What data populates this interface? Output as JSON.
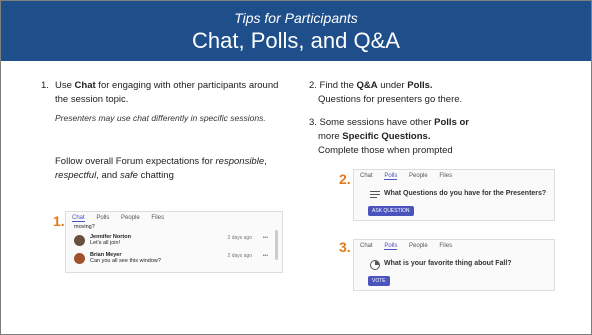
{
  "header": {
    "subtitle": "Tips for Participants",
    "title": "Chat, Polls, and Q&A",
    "band_color": "#1f4f8b"
  },
  "left": {
    "num": "1.",
    "line1_pre": "Use ",
    "line1_bold": "Chat",
    "line1_post": " for engaging with other participants around the session topic.",
    "note": "Presenters may use chat differently in specific sessions.",
    "follow_pre": "Follow overall Forum expectations for ",
    "follow_i1": "responsible",
    "follow_c1": ", ",
    "follow_i2": "respectful",
    "follow_c2": ", and ",
    "follow_i3": "safe",
    "follow_post": " chatting"
  },
  "right": {
    "p2_pre": "2. Find the ",
    "p2_b1": "Q&A",
    "p2_mid": " under ",
    "p2_b2": "Polls.",
    "p2_line2": "Questions for presenters go there.",
    "p3_pre": "3. Some sessions have other ",
    "p3_b1": "Polls or",
    "p3_mid": " more ",
    "p3_b2": "Specific Questions.",
    "p3_line3": "Complete those when prompted"
  },
  "shots": {
    "chat": {
      "step": "1.",
      "tabs": [
        "Chat",
        "Polls",
        "People",
        "Files"
      ],
      "active_tab": "Chat",
      "partial": "moving?",
      "messages": [
        {
          "name": "Jennifer Norton",
          "text": "Let's all join!",
          "time": "2 days ago"
        },
        {
          "name": "Brian Meyer",
          "text": "Can you all see this window?",
          "time": "2 days ago"
        }
      ],
      "more": "•••"
    },
    "qa": {
      "step": "2.",
      "tabs": [
        "Chat",
        "Polls",
        "People",
        "Files"
      ],
      "active_tab": "Polls",
      "question": "What Questions do you have for the Presenters?",
      "button": "ASK QUESTION"
    },
    "poll": {
      "step": "3.",
      "tabs": [
        "Chat",
        "Polls",
        "People",
        "Files"
      ],
      "active_tab": "Polls",
      "question": "What is your favorite thing about Fall?",
      "button": "VOTE"
    }
  },
  "colors": {
    "accent": "#4b53bc",
    "step": "#e07a1a"
  }
}
